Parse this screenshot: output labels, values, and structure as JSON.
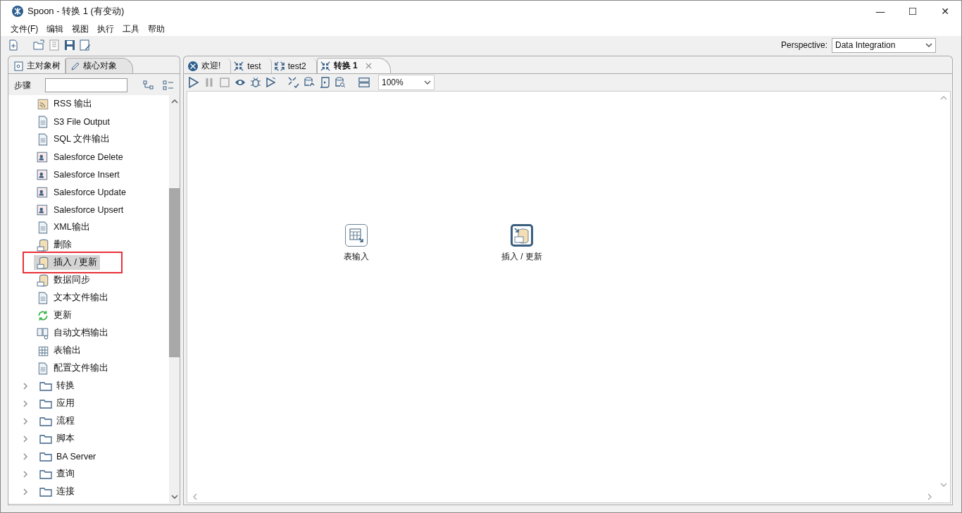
{
  "window": {
    "title": "Spoon - 转换 1 (有变动)",
    "controls": [
      "—",
      "☐",
      "✕"
    ]
  },
  "menu": [
    "文件(F)",
    "编辑",
    "视图",
    "执行",
    "工具",
    "帮助"
  ],
  "toolbar": {
    "perspective_label": "Perspective:",
    "perspective": "Data Integration"
  },
  "left_tabs": [
    {
      "label": "主对象树",
      "selected": false,
      "kind": "tree"
    },
    {
      "label": "核心对象",
      "selected": true,
      "kind": "pencil"
    }
  ],
  "steps_search": {
    "label": "步骤"
  },
  "steps": [
    {
      "label": "RSS 输出",
      "kind": "rss",
      "selected": false,
      "highlighted": false
    },
    {
      "label": "S3 File Output",
      "kind": "file",
      "selected": false,
      "highlighted": false
    },
    {
      "label": "SQL 文件输出",
      "kind": "file",
      "selected": false,
      "highlighted": false
    },
    {
      "label": "Salesforce Delete",
      "kind": "salesforce",
      "selected": false,
      "highlighted": false
    },
    {
      "label": "Salesforce Insert",
      "kind": "salesforce",
      "selected": false,
      "highlighted": false
    },
    {
      "label": "Salesforce Update",
      "kind": "salesforce",
      "selected": false,
      "highlighted": false
    },
    {
      "label": "Salesforce Upsert",
      "kind": "salesforce",
      "selected": false,
      "highlighted": false
    },
    {
      "label": "XML输出",
      "kind": "file",
      "selected": false,
      "highlighted": false
    },
    {
      "label": "删除",
      "kind": "db",
      "selected": false,
      "highlighted": false
    },
    {
      "label": "插入 / 更新",
      "kind": "db",
      "selected": true,
      "highlighted": true
    },
    {
      "label": "数据同步",
      "kind": "db",
      "selected": false,
      "highlighted": false
    },
    {
      "label": "文本文件输出",
      "kind": "file",
      "selected": false,
      "highlighted": false
    },
    {
      "label": "更新",
      "kind": "refresh",
      "selected": false,
      "highlighted": false
    },
    {
      "label": "自动文档输出",
      "kind": "book",
      "selected": false,
      "highlighted": false
    },
    {
      "label": "表输出",
      "kind": "table",
      "selected": false,
      "highlighted": false
    },
    {
      "label": "配置文件输出",
      "kind": "file",
      "selected": false,
      "highlighted": false
    }
  ],
  "categories": [
    {
      "label": "转换",
      "expanded": false
    },
    {
      "label": "应用",
      "expanded": false
    },
    {
      "label": "流程",
      "expanded": false
    },
    {
      "label": "脚本",
      "expanded": false
    },
    {
      "label": "BA Server",
      "expanded": false
    },
    {
      "label": "查询",
      "expanded": false
    },
    {
      "label": "连接",
      "expanded": false
    }
  ],
  "editor_tabs": [
    {
      "label": "欢迎!",
      "kind": "welcome",
      "selected": false,
      "closable": false
    },
    {
      "label": "test",
      "kind": "transform",
      "selected": false,
      "closable": false
    },
    {
      "label": "test2",
      "kind": "job",
      "selected": false,
      "closable": false
    },
    {
      "label": "转换 1",
      "kind": "transform",
      "selected": true,
      "closable": true
    }
  ],
  "zoom": "100%",
  "canvas_steps": [
    {
      "label": "表输入",
      "kind": "table",
      "selected": false
    },
    {
      "label": "插入 / 更新",
      "kind": "db",
      "selected": true
    }
  ]
}
